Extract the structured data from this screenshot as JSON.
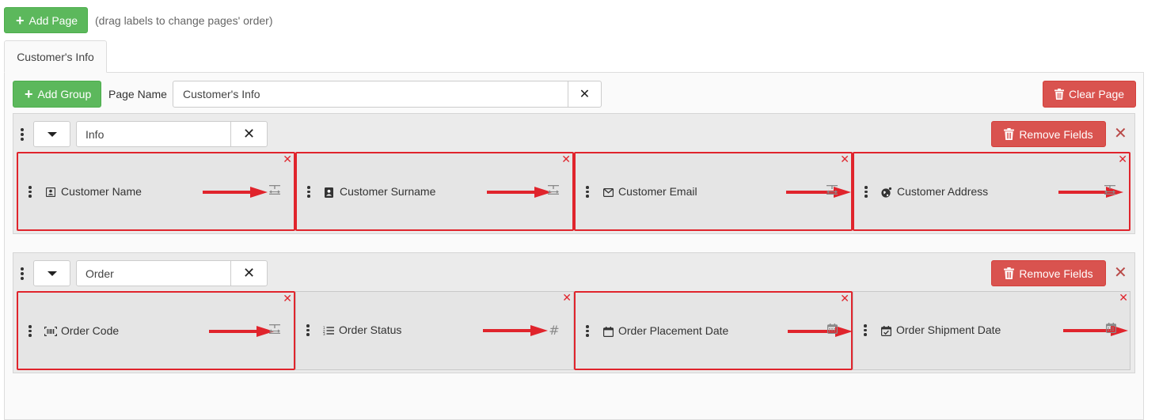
{
  "toolbar": {
    "add_page_label": "Add Page",
    "hint": "(drag labels to change pages' order)"
  },
  "tabs": [
    {
      "label": "Customer's Info"
    }
  ],
  "page": {
    "add_group_label": "Add Group",
    "page_name_label": "Page Name",
    "page_name_value": "Customer's Info",
    "clear_page_label": "Clear Page"
  },
  "groups": [
    {
      "name": "Info",
      "remove_fields_label": "Remove Fields",
      "fields": [
        {
          "label": "Customer Name",
          "icon": "contact-card-icon",
          "type_icon": "text-field-icon",
          "highlighted": true
        },
        {
          "label": "Customer Surname",
          "icon": "address-book-icon",
          "type_icon": "text-field-icon",
          "highlighted": true
        },
        {
          "label": "Customer Email",
          "icon": "envelope-icon",
          "type_icon": "text-field-icon",
          "highlighted": true
        },
        {
          "label": "Customer Address",
          "icon": "globe-icon",
          "type_icon": "text-field-icon",
          "highlighted": true
        }
      ]
    },
    {
      "name": "Order",
      "remove_fields_label": "Remove Fields",
      "fields": [
        {
          "label": "Order Code",
          "icon": "barcode-icon",
          "type_icon": "text-field-icon",
          "highlighted": true
        },
        {
          "label": "Order Status",
          "icon": "list-icon",
          "type_icon": "number-hash-icon",
          "highlighted": false
        },
        {
          "label": "Order Placement Date",
          "icon": "calendar-icon",
          "type_icon": "date-calendar-icon",
          "highlighted": true
        },
        {
          "label": "Order Shipment Date",
          "icon": "calendar-check-icon",
          "type_icon": "date-calendar-icon",
          "highlighted": false
        }
      ]
    }
  ],
  "colors": {
    "green": "#5cb85c",
    "red": "#d9534f",
    "highlight": "#e0242c",
    "arrow": "#e0242c"
  }
}
